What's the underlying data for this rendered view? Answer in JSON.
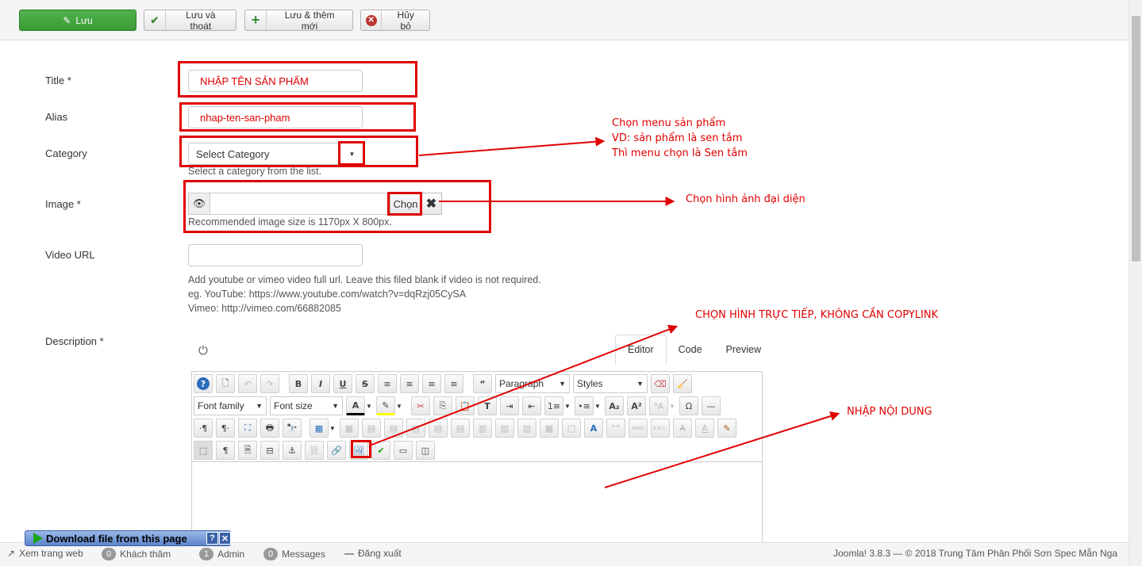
{
  "toolbar": {
    "save": "Lưu",
    "save_close": "Lưu và thoát",
    "save_new": "Lưu & thêm mới",
    "cancel": "Hủy bỏ"
  },
  "form": {
    "title_label": "Title *",
    "title_value": "NHẬP TÊN SẢN PHẨM",
    "alias_label": "Alias",
    "alias_value": "nhap-ten-san-pham",
    "category_label": "Category",
    "category_value": "Select Category",
    "category_hint": "Select a category from the list.",
    "image_label": "Image *",
    "image_button": "Chọn",
    "image_hint": "Recommended image size is 1170px X 800px.",
    "video_label": "Video URL",
    "video_hint_1": "Add youtube or vimeo video full url. Leave this filed blank if video is not required.",
    "video_hint_2": "eg. YouTube: https://www.youtube.com/watch?v=dqRzj05CySA",
    "video_hint_3": "Vimeo: http://vimeo.com/66882085",
    "description_label": "Description *"
  },
  "annotations": {
    "category_1": "Chọn menu sản phẩm",
    "category_2": "VD: sản phẩm là sen tắm",
    "category_3": "Thì menu chọn là Sen tắm",
    "image": "Chọn hình ảnh đại diện",
    "insert_image": "CHỌN HÌNH TRỰC TIẾP, KHÔNG CẦN COPYLINK",
    "content": "NHẬP NỘI DUNG"
  },
  "editor": {
    "tabs": [
      "Editor",
      "Code",
      "Preview"
    ],
    "format": "Paragraph",
    "styles": "Styles",
    "font_family": "Font family",
    "font_size": "Font size"
  },
  "download_bar": {
    "label": "Download file from this page"
  },
  "statusbar": {
    "view_site": "Xem trang web",
    "visitors_count": "0",
    "visitors_label": "Khách thăm",
    "admin_count": "1",
    "admin_label": "Admin",
    "messages_count": "0",
    "messages_label": "Messages",
    "logout": "Đăng xuất",
    "footer": "Joomla! 3.8.3 — © 2018 Trung Tâm Phân Phối Sơn Spec Mẫn Nga"
  },
  "colors": {
    "annotation": "#e00000",
    "save_button": "#46a546"
  }
}
